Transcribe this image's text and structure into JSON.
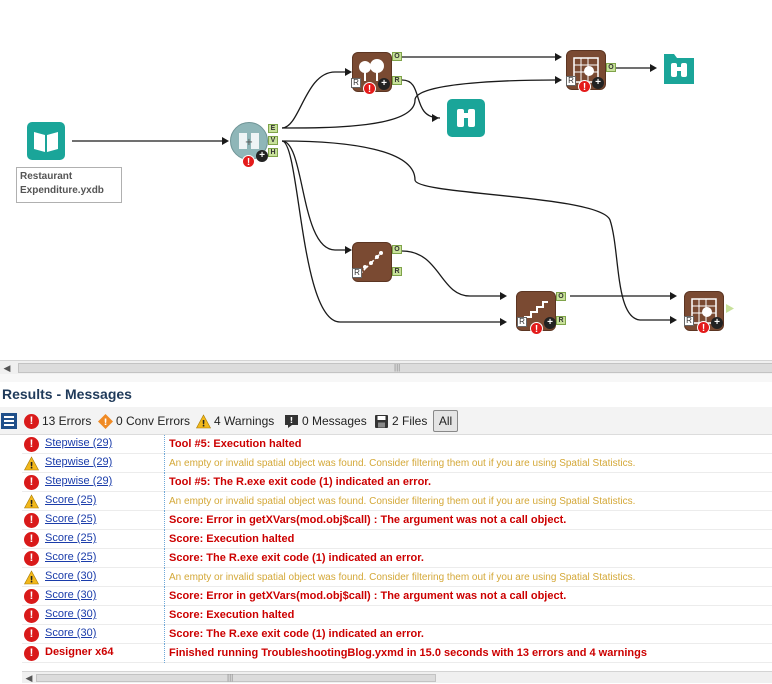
{
  "canvas": {
    "input_label": "Restaurant\nExpenditure.yxdb",
    "anchors": {
      "e": "E",
      "v": "V",
      "h": "H",
      "o": "O",
      "r": "R"
    },
    "badge_error": "!",
    "badge_plus": "+"
  },
  "results": {
    "title": "Results - Messages",
    "filters": {
      "errors": "13 Errors",
      "conv_errors": "0 Conv Errors",
      "warnings": "4 Warnings",
      "messages": "0 Messages",
      "files": "2 Files",
      "all": "All"
    },
    "rows": [
      {
        "type": "error",
        "source": "Stepwise (29)",
        "message": "Tool #5: Execution halted"
      },
      {
        "type": "warning",
        "source": "Stepwise (29)",
        "message": "An empty or invalid spatial object was found.  Consider filtering them out if you are using Spatial Statistics."
      },
      {
        "type": "error",
        "source": "Stepwise (29)",
        "message": "Tool #5: The R.exe exit code (1) indicated an error."
      },
      {
        "type": "warning",
        "source": "Score (25)",
        "message": "An empty or invalid spatial object was found.  Consider filtering them out if you are using Spatial Statistics."
      },
      {
        "type": "error",
        "source": "Score (25)",
        "message": "Score: Error in getXVars(mod.obj$call) : The argument was not a call object."
      },
      {
        "type": "error",
        "source": "Score (25)",
        "message": "Score: Execution halted"
      },
      {
        "type": "error",
        "source": "Score (25)",
        "message": "Score: The R.exe exit code (1) indicated an error."
      },
      {
        "type": "warning",
        "source": "Score (30)",
        "message": "An empty or invalid spatial object was found.  Consider filtering them out if you are using Spatial Statistics."
      },
      {
        "type": "error",
        "source": "Score (30)",
        "message": "Score: Error in getXVars(mod.obj$call) : The argument was not a call object."
      },
      {
        "type": "error",
        "source": "Score (30)",
        "message": "Score: Execution halted"
      },
      {
        "type": "error",
        "source": "Score (30)",
        "message": "Score: The R.exe exit code (1) indicated an error."
      },
      {
        "type": "error-bold",
        "source": "Designer x64",
        "message": "Finished running TroubleshootingBlog.yxmd in 15.0 seconds with 13 errors and 4 warnings"
      }
    ]
  },
  "colors": {
    "error": "#cc0000",
    "warning": "#d4a838",
    "link": "#1a3caa",
    "tool_brown": "#7a4a32",
    "tool_teal": "#1aa599"
  },
  "icons": [
    "book-icon",
    "formula-icon",
    "forest-model-icon",
    "score-icon",
    "browse-icon",
    "stepwise-icon",
    "boosted-model-icon",
    "error-icon",
    "warning-icon",
    "message-icon",
    "save-icon",
    "list-icon"
  ]
}
